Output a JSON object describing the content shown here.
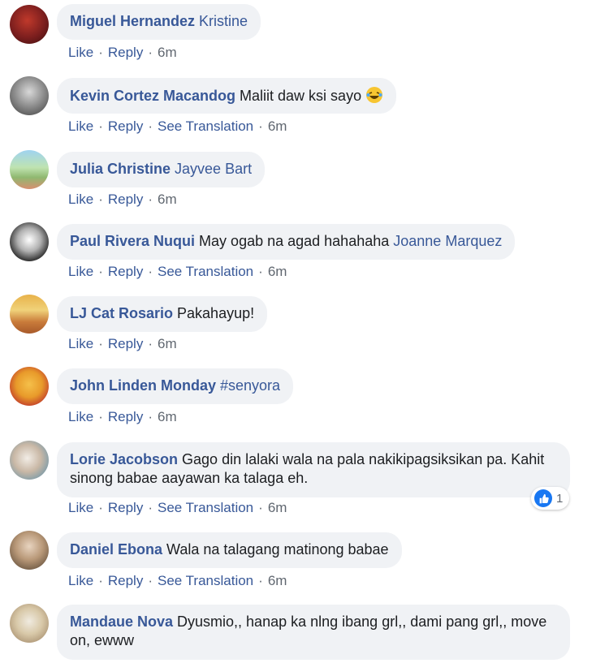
{
  "comments": [
    {
      "author": "Miguel Hernandez",
      "text": "",
      "tag": "Kristine",
      "actions": [
        "Like",
        "Reply"
      ],
      "time": "6m"
    },
    {
      "author": "Kevin Cortez Macandog",
      "text": "Maliit daw ksi sayo",
      "emoji": "laughing-tears-emoji",
      "actions": [
        "Like",
        "Reply",
        "See Translation"
      ],
      "time": "6m"
    },
    {
      "author": "Julia Christine",
      "text": "",
      "tag": "Jayvee Bart",
      "actions": [
        "Like",
        "Reply"
      ],
      "time": "6m"
    },
    {
      "author": "Paul Rivera Nuqui",
      "text": "May ogab na agad hahahaha",
      "tag": "Joanne Marquez",
      "actions": [
        "Like",
        "Reply",
        "See Translation"
      ],
      "time": "6m"
    },
    {
      "author": "LJ Cat Rosario",
      "text": "Pakahayup!",
      "actions": [
        "Like",
        "Reply"
      ],
      "time": "6m"
    },
    {
      "author": "John Linden Monday",
      "text": "",
      "tag": "#senyora",
      "actions": [
        "Like",
        "Reply"
      ],
      "time": "6m"
    },
    {
      "author": "Lorie Jacobson",
      "text": "Gago din lalaki wala na pala nakikipagsiksikan pa. Kahit sinong babae aayawan ka talaga eh.",
      "actions": [
        "Like",
        "Reply",
        "See Translation"
      ],
      "time": "6m",
      "reaction": {
        "icon": "thumbs-up-icon",
        "count": "1"
      }
    },
    {
      "author": "Daniel Ebona",
      "text": "Wala na talagang matinong babae",
      "actions": [
        "Like",
        "Reply",
        "See Translation"
      ],
      "time": "6m"
    },
    {
      "author": "Mandaue Nova",
      "text": "Dyusmio,, hanap ka nlng ibang grl,, dami pang grl,, move on, ewww"
    }
  ],
  "colors": {
    "name_link": "#385898",
    "bubble_bg": "#f0f2f5",
    "meta_text": "#606770",
    "like_blue": "#1877f2"
  }
}
